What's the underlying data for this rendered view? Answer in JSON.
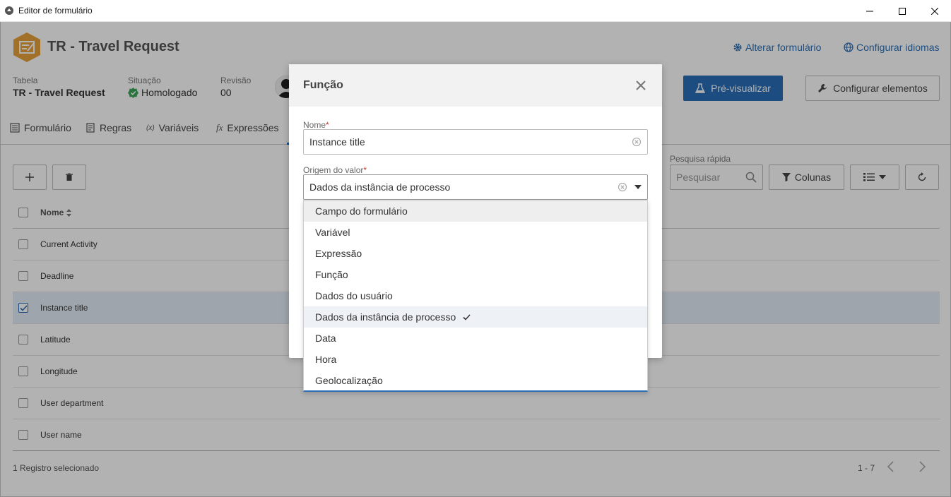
{
  "window": {
    "title": "Editor de formulário"
  },
  "header": {
    "app_title": "TR - Travel Request",
    "link_change_form": "Alterar formulário",
    "link_configure_languages": "Configurar idiomas",
    "meta": {
      "table_label": "Tabela",
      "table_value": "TR - Travel Request",
      "status_label": "Situação",
      "status_value": "Homologado",
      "revision_label": "Revisão",
      "revision_value": "00"
    },
    "preview_button": "Pré-visualizar",
    "configure_elements_button": "Configurar elementos"
  },
  "tabs": [
    {
      "label": "Formulário"
    },
    {
      "label": "Regras"
    },
    {
      "label": "Variáveis"
    },
    {
      "label": "Expressões"
    }
  ],
  "toolbar": {
    "search_label": "Pesquisa rápida",
    "search_placeholder": "Pesquisar",
    "columns_button": "Colunas"
  },
  "grid": {
    "header_name": "Nome",
    "rows": [
      {
        "name": "Current Activity",
        "checked": false
      },
      {
        "name": "Deadline",
        "checked": false
      },
      {
        "name": "Instance title",
        "checked": true
      },
      {
        "name": "Latitude",
        "checked": false
      },
      {
        "name": "Longitude",
        "checked": false
      },
      {
        "name": "User department",
        "checked": false
      },
      {
        "name": "User name",
        "checked": false
      }
    ]
  },
  "footer": {
    "selection_text": "1 Registro selecionado",
    "page_range": "1 - 7"
  },
  "modal": {
    "title": "Função",
    "name_label": "Nome",
    "name_value": "Instance title",
    "origin_label": "Origem do valor",
    "origin_value": "Dados da instância de processo",
    "options": [
      {
        "label": "Campo do formulário"
      },
      {
        "label": "Variável"
      },
      {
        "label": "Expressão"
      },
      {
        "label": "Função"
      },
      {
        "label": "Dados do usuário"
      },
      {
        "label": "Dados da instância de processo",
        "selected": true
      },
      {
        "label": "Data"
      },
      {
        "label": "Hora"
      },
      {
        "label": "Geolocalização"
      }
    ]
  },
  "colors": {
    "accent": "#2a6fb8",
    "logo": "#e8a33c",
    "status_ok": "#3aa757"
  }
}
